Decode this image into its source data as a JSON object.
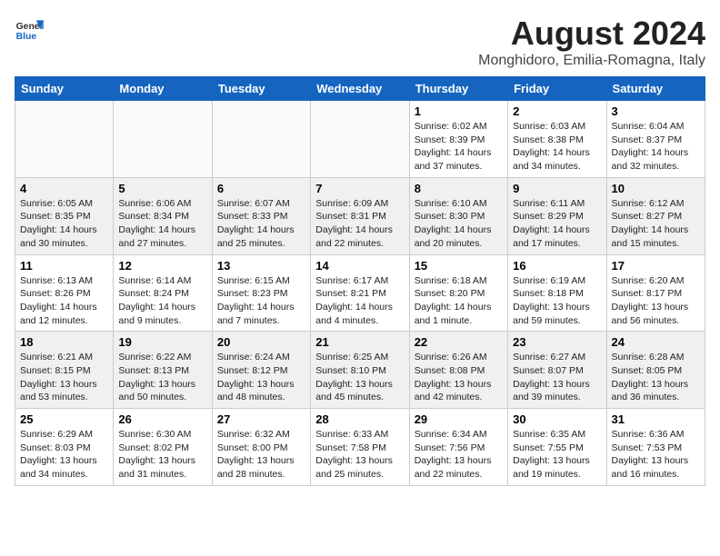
{
  "header": {
    "logo_general": "General",
    "logo_blue": "Blue",
    "title": "August 2024",
    "subtitle": "Monghidoro, Emilia-Romagna, Italy"
  },
  "weekdays": [
    "Sunday",
    "Monday",
    "Tuesday",
    "Wednesday",
    "Thursday",
    "Friday",
    "Saturday"
  ],
  "weeks": [
    [
      {
        "day": "",
        "info": ""
      },
      {
        "day": "",
        "info": ""
      },
      {
        "day": "",
        "info": ""
      },
      {
        "day": "",
        "info": ""
      },
      {
        "day": "1",
        "info": "Sunrise: 6:02 AM\nSunset: 8:39 PM\nDaylight: 14 hours\nand 37 minutes."
      },
      {
        "day": "2",
        "info": "Sunrise: 6:03 AM\nSunset: 8:38 PM\nDaylight: 14 hours\nand 34 minutes."
      },
      {
        "day": "3",
        "info": "Sunrise: 6:04 AM\nSunset: 8:37 PM\nDaylight: 14 hours\nand 32 minutes."
      }
    ],
    [
      {
        "day": "4",
        "info": "Sunrise: 6:05 AM\nSunset: 8:35 PM\nDaylight: 14 hours\nand 30 minutes."
      },
      {
        "day": "5",
        "info": "Sunrise: 6:06 AM\nSunset: 8:34 PM\nDaylight: 14 hours\nand 27 minutes."
      },
      {
        "day": "6",
        "info": "Sunrise: 6:07 AM\nSunset: 8:33 PM\nDaylight: 14 hours\nand 25 minutes."
      },
      {
        "day": "7",
        "info": "Sunrise: 6:09 AM\nSunset: 8:31 PM\nDaylight: 14 hours\nand 22 minutes."
      },
      {
        "day": "8",
        "info": "Sunrise: 6:10 AM\nSunset: 8:30 PM\nDaylight: 14 hours\nand 20 minutes."
      },
      {
        "day": "9",
        "info": "Sunrise: 6:11 AM\nSunset: 8:29 PM\nDaylight: 14 hours\nand 17 minutes."
      },
      {
        "day": "10",
        "info": "Sunrise: 6:12 AM\nSunset: 8:27 PM\nDaylight: 14 hours\nand 15 minutes."
      }
    ],
    [
      {
        "day": "11",
        "info": "Sunrise: 6:13 AM\nSunset: 8:26 PM\nDaylight: 14 hours\nand 12 minutes."
      },
      {
        "day": "12",
        "info": "Sunrise: 6:14 AM\nSunset: 8:24 PM\nDaylight: 14 hours\nand 9 minutes."
      },
      {
        "day": "13",
        "info": "Sunrise: 6:15 AM\nSunset: 8:23 PM\nDaylight: 14 hours\nand 7 minutes."
      },
      {
        "day": "14",
        "info": "Sunrise: 6:17 AM\nSunset: 8:21 PM\nDaylight: 14 hours\nand 4 minutes."
      },
      {
        "day": "15",
        "info": "Sunrise: 6:18 AM\nSunset: 8:20 PM\nDaylight: 14 hours\nand 1 minute."
      },
      {
        "day": "16",
        "info": "Sunrise: 6:19 AM\nSunset: 8:18 PM\nDaylight: 13 hours\nand 59 minutes."
      },
      {
        "day": "17",
        "info": "Sunrise: 6:20 AM\nSunset: 8:17 PM\nDaylight: 13 hours\nand 56 minutes."
      }
    ],
    [
      {
        "day": "18",
        "info": "Sunrise: 6:21 AM\nSunset: 8:15 PM\nDaylight: 13 hours\nand 53 minutes."
      },
      {
        "day": "19",
        "info": "Sunrise: 6:22 AM\nSunset: 8:13 PM\nDaylight: 13 hours\nand 50 minutes."
      },
      {
        "day": "20",
        "info": "Sunrise: 6:24 AM\nSunset: 8:12 PM\nDaylight: 13 hours\nand 48 minutes."
      },
      {
        "day": "21",
        "info": "Sunrise: 6:25 AM\nSunset: 8:10 PM\nDaylight: 13 hours\nand 45 minutes."
      },
      {
        "day": "22",
        "info": "Sunrise: 6:26 AM\nSunset: 8:08 PM\nDaylight: 13 hours\nand 42 minutes."
      },
      {
        "day": "23",
        "info": "Sunrise: 6:27 AM\nSunset: 8:07 PM\nDaylight: 13 hours\nand 39 minutes."
      },
      {
        "day": "24",
        "info": "Sunrise: 6:28 AM\nSunset: 8:05 PM\nDaylight: 13 hours\nand 36 minutes."
      }
    ],
    [
      {
        "day": "25",
        "info": "Sunrise: 6:29 AM\nSunset: 8:03 PM\nDaylight: 13 hours\nand 34 minutes."
      },
      {
        "day": "26",
        "info": "Sunrise: 6:30 AM\nSunset: 8:02 PM\nDaylight: 13 hours\nand 31 minutes."
      },
      {
        "day": "27",
        "info": "Sunrise: 6:32 AM\nSunset: 8:00 PM\nDaylight: 13 hours\nand 28 minutes."
      },
      {
        "day": "28",
        "info": "Sunrise: 6:33 AM\nSunset: 7:58 PM\nDaylight: 13 hours\nand 25 minutes."
      },
      {
        "day": "29",
        "info": "Sunrise: 6:34 AM\nSunset: 7:56 PM\nDaylight: 13 hours\nand 22 minutes."
      },
      {
        "day": "30",
        "info": "Sunrise: 6:35 AM\nSunset: 7:55 PM\nDaylight: 13 hours\nand 19 minutes."
      },
      {
        "day": "31",
        "info": "Sunrise: 6:36 AM\nSunset: 7:53 PM\nDaylight: 13 hours\nand 16 minutes."
      }
    ]
  ]
}
